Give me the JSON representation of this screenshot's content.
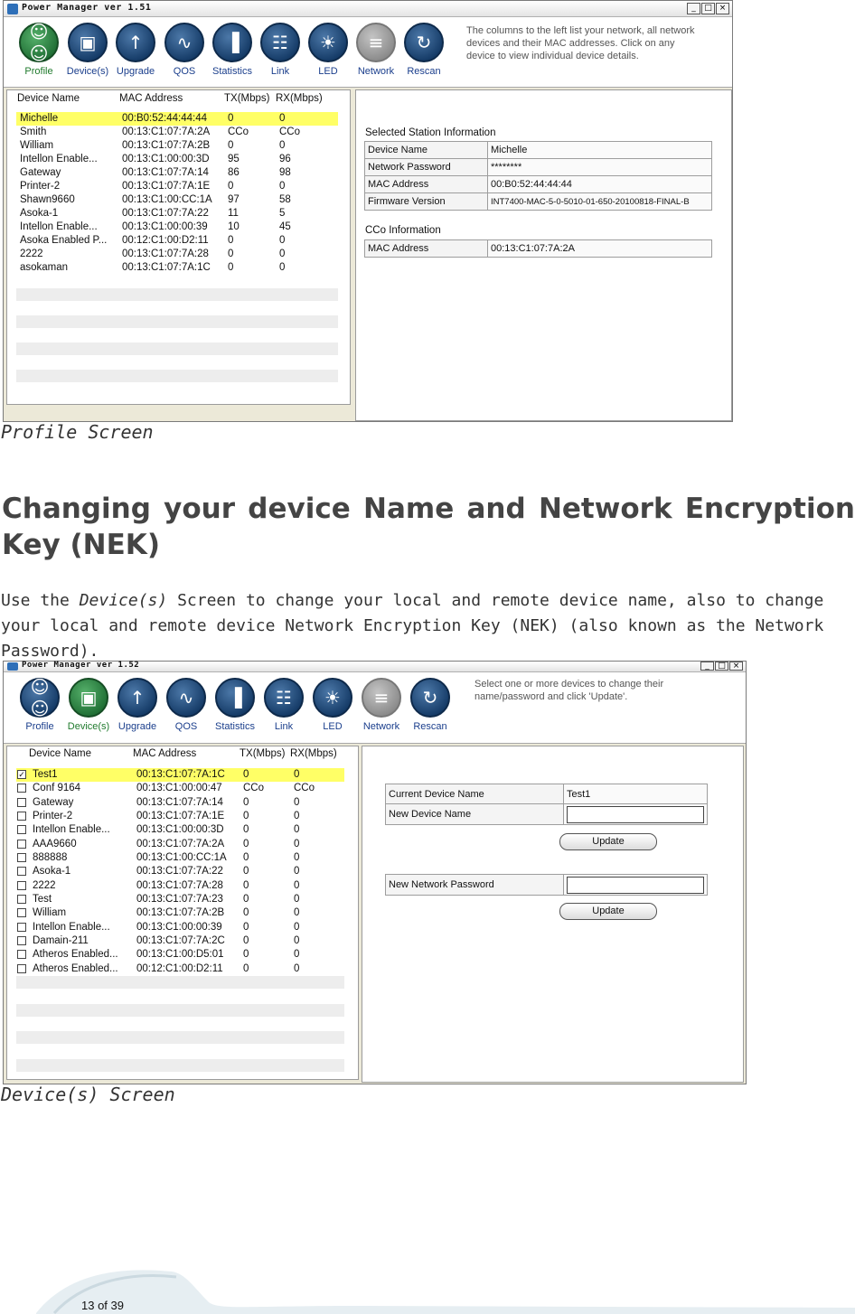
{
  "screen1": {
    "window_title": "Power Manager ver 1.51",
    "toolbar": [
      {
        "label": "Profile",
        "icon": "people-icon",
        "active": true
      },
      {
        "label": "Device(s)",
        "icon": "devices-icon",
        "active": false
      },
      {
        "label": "Upgrade",
        "icon": "upgrade-icon",
        "active": false
      },
      {
        "label": "QOS",
        "icon": "qos-wave-icon",
        "active": false
      },
      {
        "label": "Statistics",
        "icon": "statistics-icon",
        "active": false
      },
      {
        "label": "Link",
        "icon": "link-icon",
        "active": false
      },
      {
        "label": "LED",
        "icon": "led-icon",
        "active": false
      },
      {
        "label": "Network",
        "icon": "network-icon",
        "active": false
      },
      {
        "label": "Rescan",
        "icon": "rescan-icon",
        "active": false
      }
    ],
    "hint": [
      "The columns to the left list your network, all network",
      "devices and their MAC addresses. Click on any",
      "device to view individual device details."
    ],
    "columns": [
      "Device Name",
      "MAC Address",
      "TX(Mbps)",
      "RX(Mbps)"
    ],
    "rows": [
      [
        "Michelle",
        "00:B0:52:44:44:44",
        "0",
        "0"
      ],
      [
        "Smith",
        "00:13:C1:07:7A:2A",
        "CCo",
        "CCo"
      ],
      [
        "William",
        "00:13:C1:07:7A:2B",
        "0",
        "0"
      ],
      [
        "Intellon Enable...",
        "00:13:C1:00:00:3D",
        "95",
        "96"
      ],
      [
        "Gateway",
        "00:13:C1:07:7A:14",
        "86",
        "98"
      ],
      [
        "Printer-2",
        "00:13:C1:07:7A:1E",
        "0",
        "0"
      ],
      [
        "Shawn9660",
        "00:13:C1:00:CC:1A",
        "97",
        "58"
      ],
      [
        "Asoka-1",
        "00:13:C1:07:7A:22",
        "11",
        "5"
      ],
      [
        "Intellon Enable...",
        "00:13:C1:00:00:39",
        "10",
        "45"
      ],
      [
        "Asoka Enabled P...",
        "00:12:C1:00:D2:11",
        "0",
        "0"
      ],
      [
        "2222",
        "00:13:C1:07:7A:28",
        "0",
        "0"
      ],
      [
        "asokaman",
        "00:13:C1:07:7A:1C",
        "0",
        "0"
      ]
    ],
    "selected_title": "Selected Station Information",
    "selected": [
      [
        "Device Name",
        "Michelle"
      ],
      [
        "Network Password",
        "********"
      ],
      [
        "MAC Address",
        "00:B0:52:44:44:44"
      ],
      [
        "Firmware Version",
        "INT7400-MAC-5-0-5010-01-650-20100818-FINAL-B"
      ]
    ],
    "cco_title": "CCo Information",
    "cco": [
      [
        "MAC Address",
        "00:13:C1:07:7A:2A"
      ]
    ]
  },
  "caption1": "Profile Screen",
  "heading": "Changing your device Name and Network Encryption Key (NEK)",
  "paragraph": {
    "pre": "Use the ",
    "em": "Device(s)",
    "post": " Screen to change your local and remote device name, also to change your local and remote device Network Encryption Key (NEK) (also known as the Network Password)."
  },
  "screen2": {
    "window_title": "Power Manager ver 1.52",
    "toolbar": [
      {
        "label": "Profile",
        "icon": "people-icon",
        "active": false
      },
      {
        "label": "Device(s)",
        "icon": "devices-icon",
        "active": true
      },
      {
        "label": "Upgrade",
        "icon": "upgrade-icon",
        "active": false
      },
      {
        "label": "QOS",
        "icon": "qos-wave-icon",
        "active": false
      },
      {
        "label": "Statistics",
        "icon": "statistics-icon",
        "active": false
      },
      {
        "label": "Link",
        "icon": "link-icon",
        "active": false
      },
      {
        "label": "LED",
        "icon": "led-icon",
        "active": false
      },
      {
        "label": "Network",
        "icon": "network-icon",
        "active": false
      },
      {
        "label": "Rescan",
        "icon": "rescan-icon",
        "active": false
      }
    ],
    "hint": [
      "Select one or more devices to change their",
      "name/password and click 'Update'."
    ],
    "columns": [
      "Device Name",
      "MAC Address",
      "TX(Mbps)",
      "RX(Mbps)"
    ],
    "rows": [
      [
        "Test1",
        "00:13:C1:07:7A:1C",
        "0",
        "0",
        true
      ],
      [
        "Conf 9164",
        "00:13:C1:00:00:47",
        "CCo",
        "CCo",
        false
      ],
      [
        "Gateway",
        "00:13:C1:07:7A:14",
        "0",
        "0",
        false
      ],
      [
        "Printer-2",
        "00:13:C1:07:7A:1E",
        "0",
        "0",
        false
      ],
      [
        "Intellon Enable...",
        "00:13:C1:00:00:3D",
        "0",
        "0",
        false
      ],
      [
        "AAA9660",
        "00:13:C1:07:7A:2A",
        "0",
        "0",
        false
      ],
      [
        "888888",
        "00:13:C1:00:CC:1A",
        "0",
        "0",
        false
      ],
      [
        "Asoka-1",
        "00:13:C1:07:7A:22",
        "0",
        "0",
        false
      ],
      [
        "2222",
        "00:13:C1:07:7A:28",
        "0",
        "0",
        false
      ],
      [
        "Test",
        "00:13:C1:07:7A:23",
        "0",
        "0",
        false
      ],
      [
        "William",
        "00:13:C1:07:7A:2B",
        "0",
        "0",
        false
      ],
      [
        "Intellon Enable...",
        "00:13:C1:00:00:39",
        "0",
        "0",
        false
      ],
      [
        "Damain-211",
        "00:13:C1:07:7A:2C",
        "0",
        "0",
        false
      ],
      [
        "Atheros Enabled...",
        "00:13:C1:00:D5:01",
        "0",
        "0",
        false
      ],
      [
        "Atheros Enabled...",
        "00:12:C1:00:D2:11",
        "0",
        "0",
        false
      ]
    ],
    "current_name_label": "Current Device Name",
    "current_name_value": "Test1",
    "new_name_label": "New Device Name",
    "new_name_value": "",
    "update_label": "Update",
    "new_password_label": "New Network Password",
    "new_password_value": ""
  },
  "caption2": "Device(s) Screen",
  "page_number": "13 of 39"
}
